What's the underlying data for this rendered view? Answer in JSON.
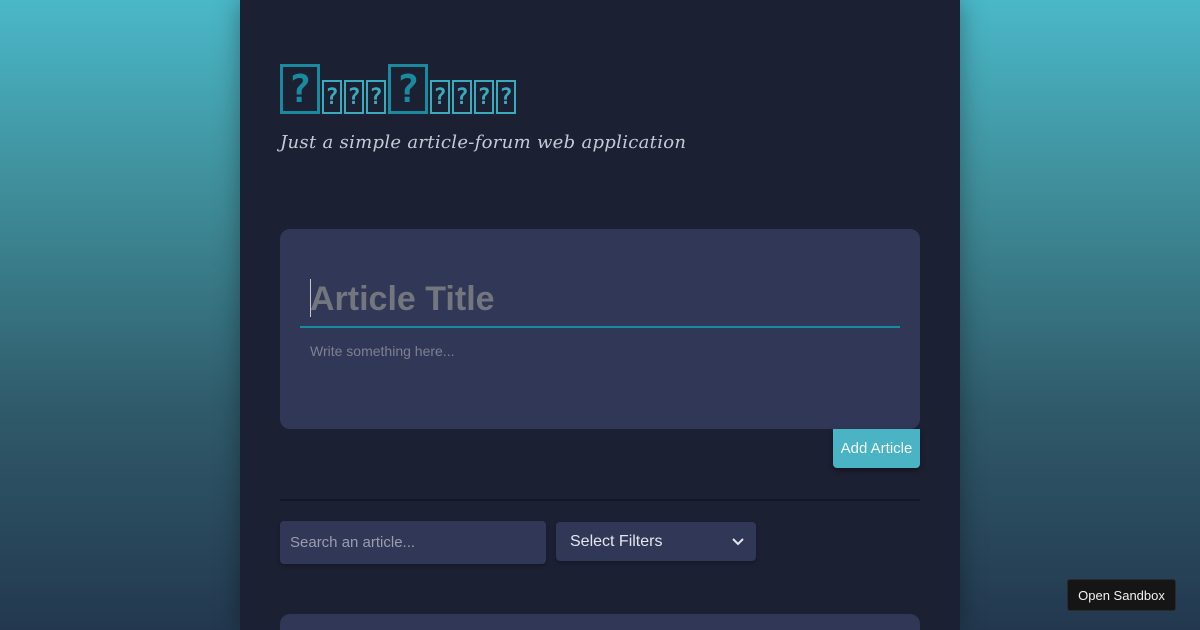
{
  "header": {
    "logo_glyphs": [
      "?",
      "?",
      "?",
      "?",
      "?",
      "?",
      "?",
      "?",
      "?",
      "?"
    ],
    "tagline": "Just a simple article-forum web application"
  },
  "editor": {
    "title_placeholder": "Article Title",
    "body_placeholder": "Write something here...",
    "add_label": "Add Article"
  },
  "toolbar": {
    "search_placeholder": "Search an article...",
    "filters_label": "Select Filters"
  },
  "sandbox": {
    "label": "Open Sandbox"
  },
  "colors": {
    "accent": "#4ab3c4",
    "logo": "#1a8a9e",
    "panel": "#1c2033",
    "card": "#313756"
  }
}
